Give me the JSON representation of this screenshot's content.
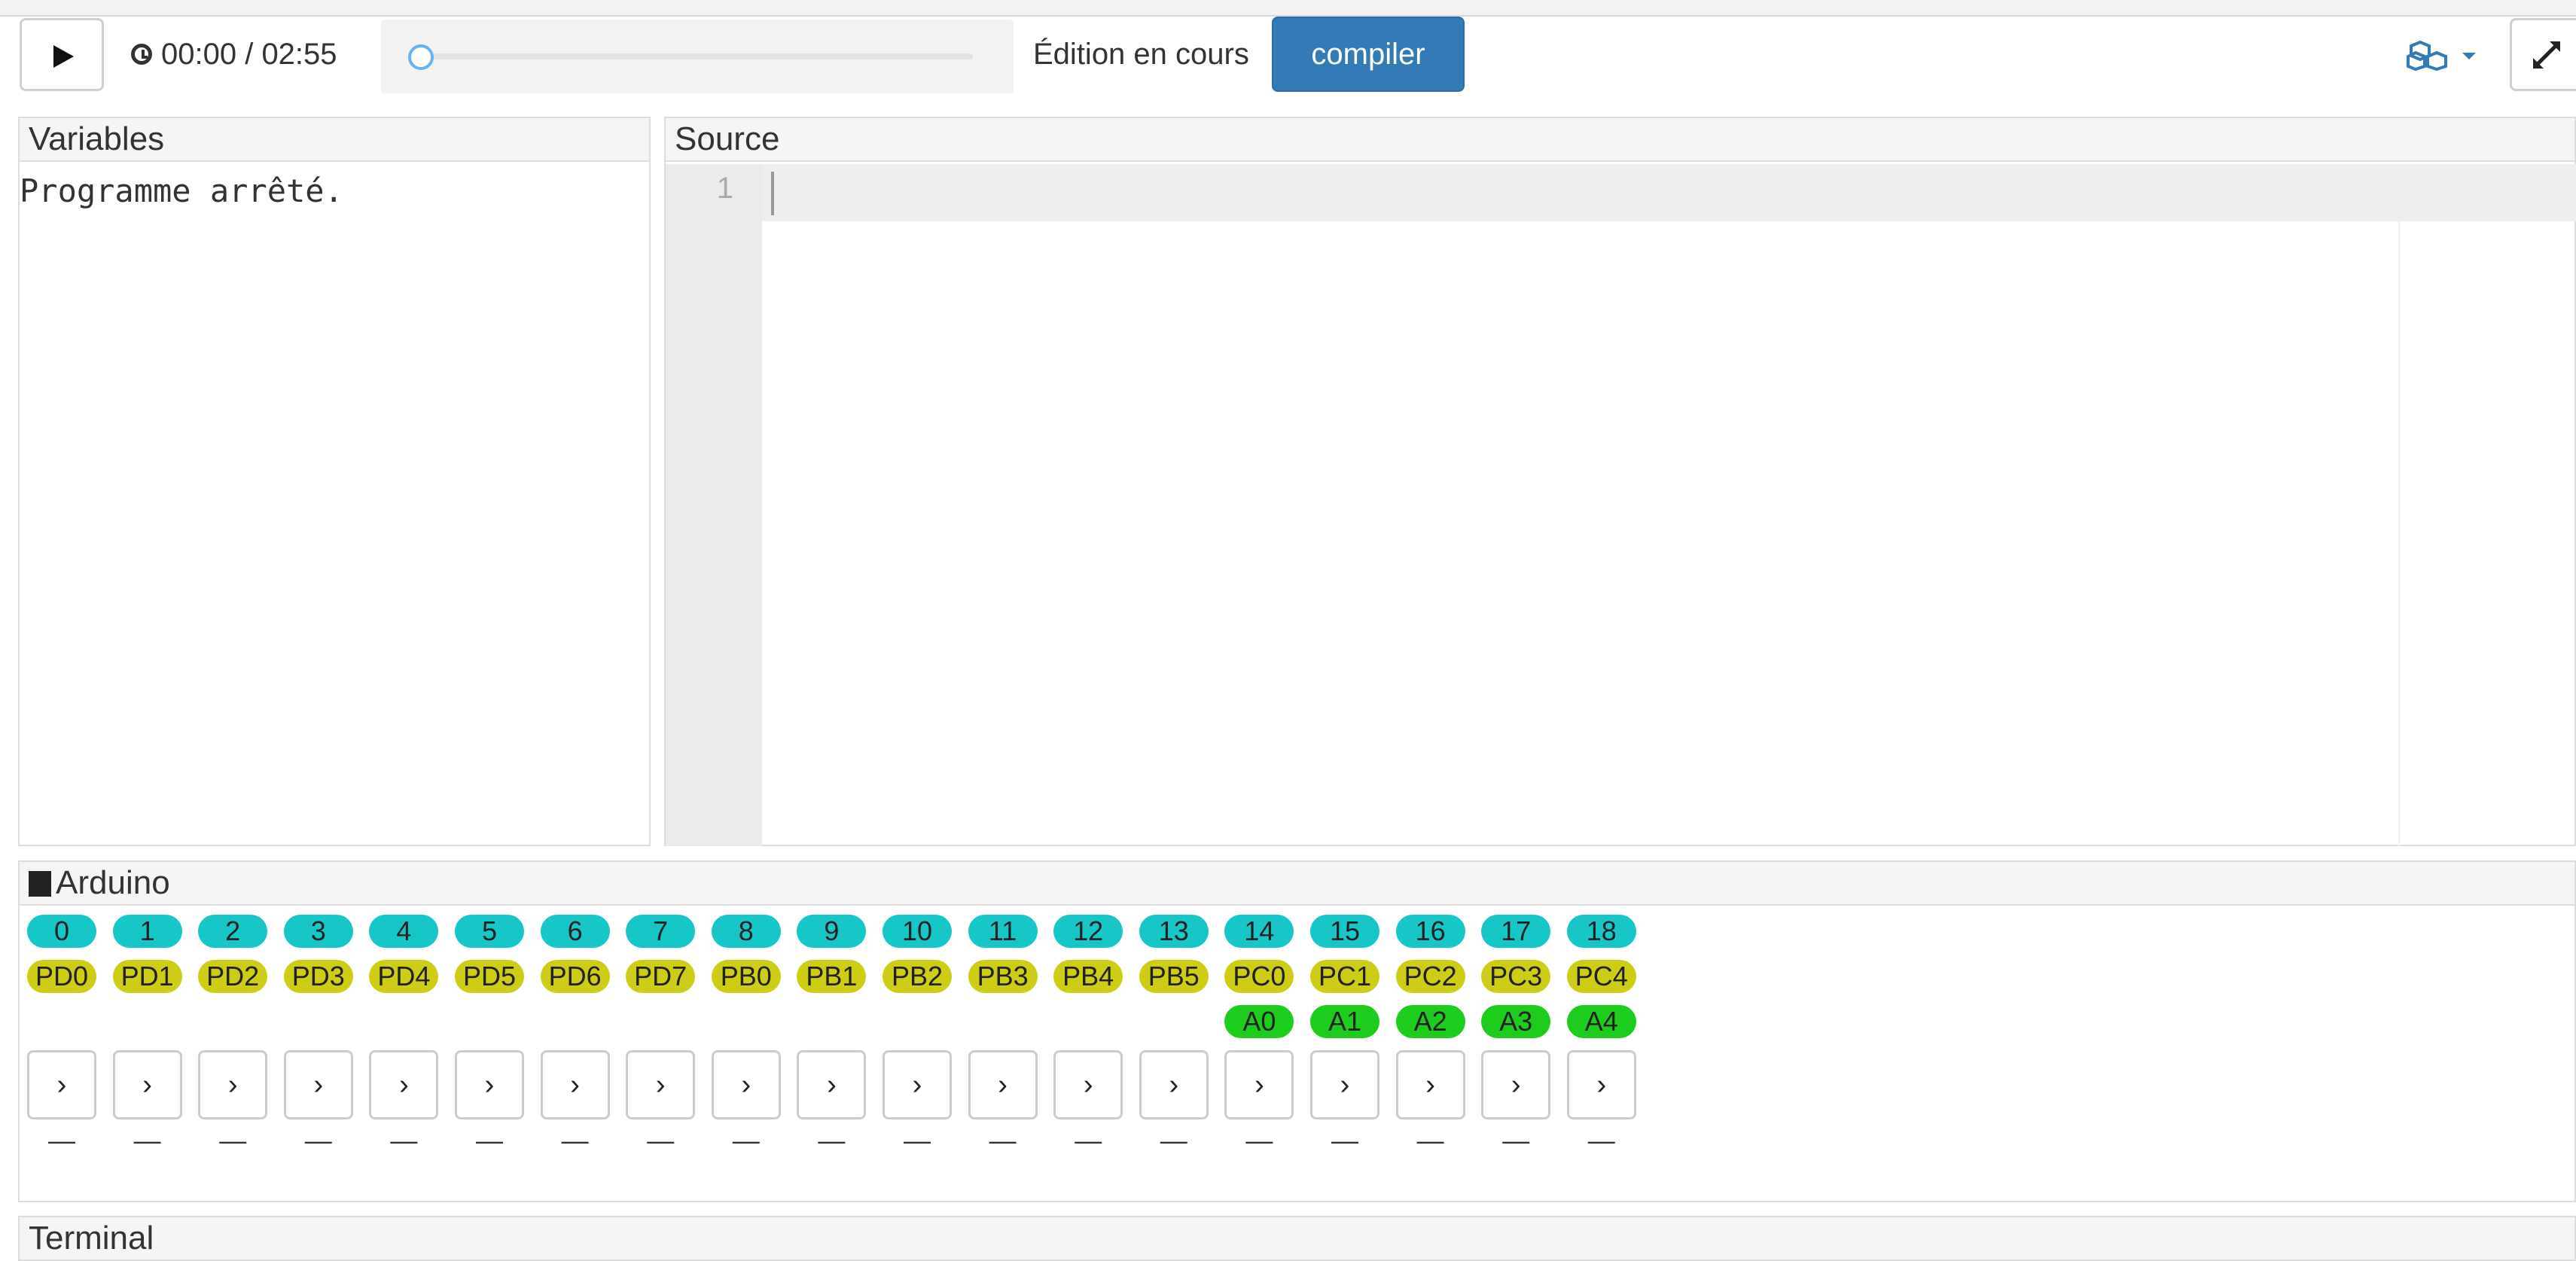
{
  "toolbar": {
    "play_icon": "play-icon",
    "time": "00:00 / 02:55",
    "progress": 0,
    "status": "Édition en cours",
    "compile_label": "compiler",
    "settings_icon": "cubes-icon",
    "expand_icon": "expand-icon"
  },
  "variables": {
    "title": "Variables",
    "content": "Programme arrêté."
  },
  "source": {
    "title": "Source",
    "line_numbers": [
      "1"
    ]
  },
  "arduino": {
    "title": "Arduino",
    "pins": [
      {
        "num": "0",
        "port": "PD0",
        "analog": "",
        "arrow": "›",
        "value": "—"
      },
      {
        "num": "1",
        "port": "PD1",
        "analog": "",
        "arrow": "›",
        "value": "—"
      },
      {
        "num": "2",
        "port": "PD2",
        "analog": "",
        "arrow": "›",
        "value": "—"
      },
      {
        "num": "3",
        "port": "PD3",
        "analog": "",
        "arrow": "›",
        "value": "—"
      },
      {
        "num": "4",
        "port": "PD4",
        "analog": "",
        "arrow": "›",
        "value": "—"
      },
      {
        "num": "5",
        "port": "PD5",
        "analog": "",
        "arrow": "›",
        "value": "—"
      },
      {
        "num": "6",
        "port": "PD6",
        "analog": "",
        "arrow": "›",
        "value": "—"
      },
      {
        "num": "7",
        "port": "PD7",
        "analog": "",
        "arrow": "›",
        "value": "—"
      },
      {
        "num": "8",
        "port": "PB0",
        "analog": "",
        "arrow": "›",
        "value": "—"
      },
      {
        "num": "9",
        "port": "PB1",
        "analog": "",
        "arrow": "›",
        "value": "—"
      },
      {
        "num": "10",
        "port": "PB2",
        "analog": "",
        "arrow": "›",
        "value": "—"
      },
      {
        "num": "11",
        "port": "PB3",
        "analog": "",
        "arrow": "›",
        "value": "—"
      },
      {
        "num": "12",
        "port": "PB4",
        "analog": "",
        "arrow": "›",
        "value": "—"
      },
      {
        "num": "13",
        "port": "PB5",
        "analog": "",
        "arrow": "›",
        "value": "—"
      },
      {
        "num": "14",
        "port": "PC0",
        "analog": "A0",
        "arrow": "›",
        "value": "—"
      },
      {
        "num": "15",
        "port": "PC1",
        "analog": "A1",
        "arrow": "›",
        "value": "—"
      },
      {
        "num": "16",
        "port": "PC2",
        "analog": "A2",
        "arrow": "›",
        "value": "—"
      },
      {
        "num": "17",
        "port": "PC3",
        "analog": "A3",
        "arrow": "›",
        "value": "—"
      },
      {
        "num": "18",
        "port": "PC4",
        "analog": "A4",
        "arrow": "›",
        "value": "—"
      }
    ]
  },
  "terminal": {
    "title": "Terminal"
  }
}
